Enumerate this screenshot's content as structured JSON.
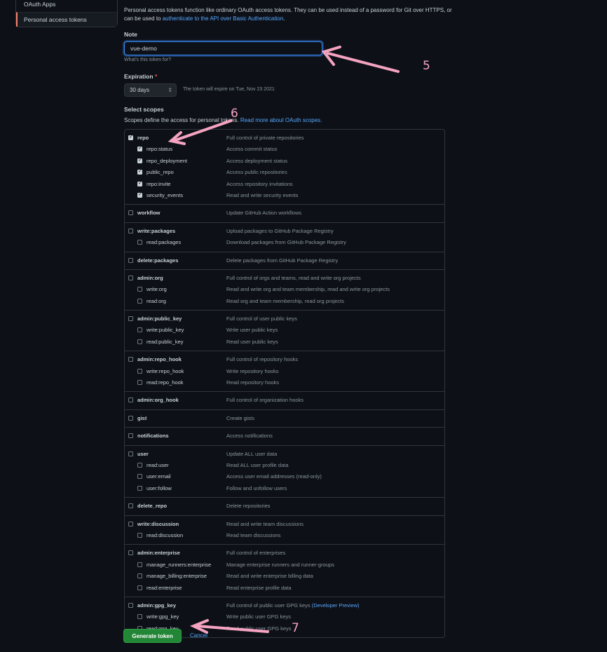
{
  "sidebar": {
    "items": [
      {
        "label": "OAuth Apps"
      },
      {
        "label": "Personal access tokens"
      }
    ]
  },
  "intro": {
    "text": "Personal access tokens function like ordinary OAuth access tokens. They can be used instead of a password for Git over HTTPS, or can be used to ",
    "link": "authenticate to the API over Basic Authentication",
    "end": "."
  },
  "note": {
    "label": "Note",
    "value": "vue-demo",
    "hint": "What's this token for?"
  },
  "expiration": {
    "label": "Expiration",
    "required": "*",
    "selected": "30 days",
    "note": "The token will expire on Tue, Nov 23 2021"
  },
  "scopes": {
    "heading": "Select scopes",
    "desc": "Scopes define the access for personal tokens.",
    "link": "Read more about OAuth scopes.",
    "groups": [
      {
        "name": "repo",
        "desc": "Full control of private repositories",
        "checked": true,
        "children": [
          {
            "name": "repo:status",
            "desc": "Access commit status",
            "checked": true
          },
          {
            "name": "repo_deployment",
            "desc": "Access deployment status",
            "checked": true
          },
          {
            "name": "public_repo",
            "desc": "Access public repositories",
            "checked": true
          },
          {
            "name": "repo:invite",
            "desc": "Access repository invitations",
            "checked": true
          },
          {
            "name": "security_events",
            "desc": "Read and write security events",
            "checked": true
          }
        ]
      },
      {
        "name": "workflow",
        "desc": "Update GitHub Action workflows",
        "checked": false,
        "children": []
      },
      {
        "name": "write:packages",
        "desc": "Upload packages to GitHub Package Registry",
        "checked": false,
        "children": [
          {
            "name": "read:packages",
            "desc": "Download packages from GitHub Package Registry",
            "checked": false
          }
        ]
      },
      {
        "name": "delete:packages",
        "desc": "Delete packages from GitHub Package Registry",
        "checked": false,
        "children": []
      },
      {
        "name": "admin:org",
        "desc": "Full control of orgs and teams, read and write org projects",
        "checked": false,
        "children": [
          {
            "name": "write:org",
            "desc": "Read and write org and team membership, read and write org projects",
            "checked": false
          },
          {
            "name": "read:org",
            "desc": "Read org and team membership, read org projects",
            "checked": false
          }
        ]
      },
      {
        "name": "admin:public_key",
        "desc": "Full control of user public keys",
        "checked": false,
        "children": [
          {
            "name": "write:public_key",
            "desc": "Write user public keys",
            "checked": false
          },
          {
            "name": "read:public_key",
            "desc": "Read user public keys",
            "checked": false
          }
        ]
      },
      {
        "name": "admin:repo_hook",
        "desc": "Full control of repository hooks",
        "checked": false,
        "children": [
          {
            "name": "write:repo_hook",
            "desc": "Write repository hooks",
            "checked": false
          },
          {
            "name": "read:repo_hook",
            "desc": "Read repository hooks",
            "checked": false
          }
        ]
      },
      {
        "name": "admin:org_hook",
        "desc": "Full control of organization hooks",
        "checked": false,
        "children": []
      },
      {
        "name": "gist",
        "desc": "Create gists",
        "checked": false,
        "children": []
      },
      {
        "name": "notifications",
        "desc": "Access notifications",
        "checked": false,
        "children": []
      },
      {
        "name": "user",
        "desc": "Update ALL user data",
        "checked": false,
        "children": [
          {
            "name": "read:user",
            "desc": "Read ALL user profile data",
            "checked": false
          },
          {
            "name": "user:email",
            "desc": "Access user email addresses (read-only)",
            "checked": false
          },
          {
            "name": "user:follow",
            "desc": "Follow and unfollow users",
            "checked": false
          }
        ]
      },
      {
        "name": "delete_repo",
        "desc": "Delete repositories",
        "checked": false,
        "children": []
      },
      {
        "name": "write:discussion",
        "desc": "Read and write team discussions",
        "checked": false,
        "children": [
          {
            "name": "read:discussion",
            "desc": "Read team discussions",
            "checked": false
          }
        ]
      },
      {
        "name": "admin:enterprise",
        "desc": "Full control of enterprises",
        "checked": false,
        "children": [
          {
            "name": "manage_runners:enterprise",
            "desc": "Manage enterprise runners and runner-groups",
            "checked": false
          },
          {
            "name": "manage_billing:enterprise",
            "desc": "Read and write enterprise billing data",
            "checked": false
          },
          {
            "name": "read:enterprise",
            "desc": "Read enterprise profile data",
            "checked": false
          }
        ]
      },
      {
        "name": "admin:gpg_key",
        "desc": "Full control of public user GPG keys",
        "desc_link": "(Developer Preview)",
        "checked": false,
        "children": [
          {
            "name": "write:gpg_key",
            "desc": "Write public user GPG keys",
            "checked": false
          },
          {
            "name": "read:gpg_key",
            "desc": "Read public user GPG keys",
            "checked": false
          }
        ]
      }
    ]
  },
  "actions": {
    "generate": "Generate token",
    "cancel": "Cancel"
  },
  "annotations": {
    "step5": "5",
    "step6": "6",
    "step7": "7",
    "color": "#f5a3c0"
  },
  "colors": {
    "background": "#0d1117",
    "link": "#58a6ff",
    "primary_button": "#238636",
    "active_marker": "#f78166"
  }
}
